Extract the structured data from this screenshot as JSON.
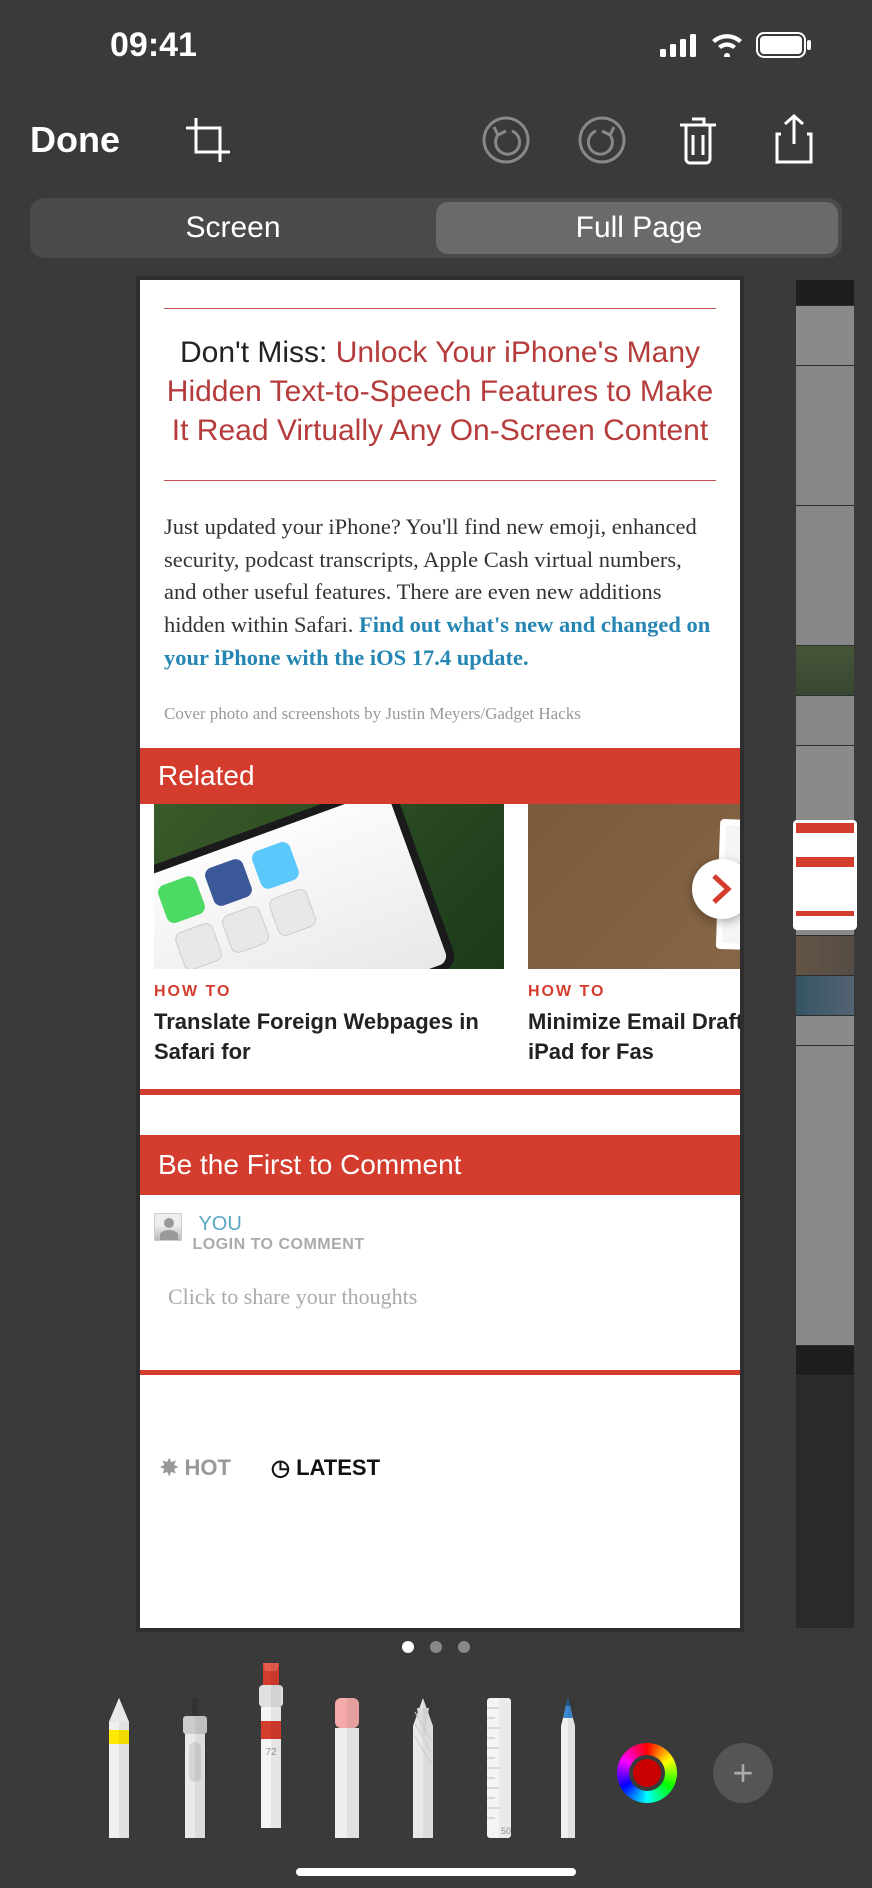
{
  "status": {
    "time": "09:41"
  },
  "editor": {
    "done": "Done"
  },
  "tabs": {
    "screen": "Screen",
    "full_page": "Full Page",
    "active": 1
  },
  "article": {
    "dont_miss_prefix": "Don't Miss: ",
    "dont_miss_link": "Unlock Your iPhone's Many Hidden Text-to-Speech Features to Make It Read Virtually Any On-Screen Content",
    "body_plain": "Just updated your iPhone? You'll find new emoji, enhanced security, podcast transcripts, Apple Cash virtual numbers, and other useful features. There are even new additions hidden within Safari. ",
    "body_link": "Find out what's new and changed on your iPhone with the iOS 17.4 update.",
    "credit": "Cover photo and screenshots by Justin Meyers/Gadget Hacks"
  },
  "related": {
    "header": "Related",
    "items": [
      {
        "tag": "HOW TO",
        "title": "Translate Foreign Webpages in Safari for"
      },
      {
        "tag": "HOW TO",
        "title": "Minimize Email Drafts iPhone or iPad for Fas"
      }
    ]
  },
  "comments": {
    "header": "Be the First to Comment",
    "you": "YOU",
    "login": "LOGIN TO COMMENT",
    "placeholder": "Click to share your thoughts"
  },
  "sort": {
    "hot": "HOT",
    "latest": "LATEST"
  },
  "tools": {
    "marker_label": "72",
    "ruler_label": "50",
    "picker_color": "#c90000"
  }
}
